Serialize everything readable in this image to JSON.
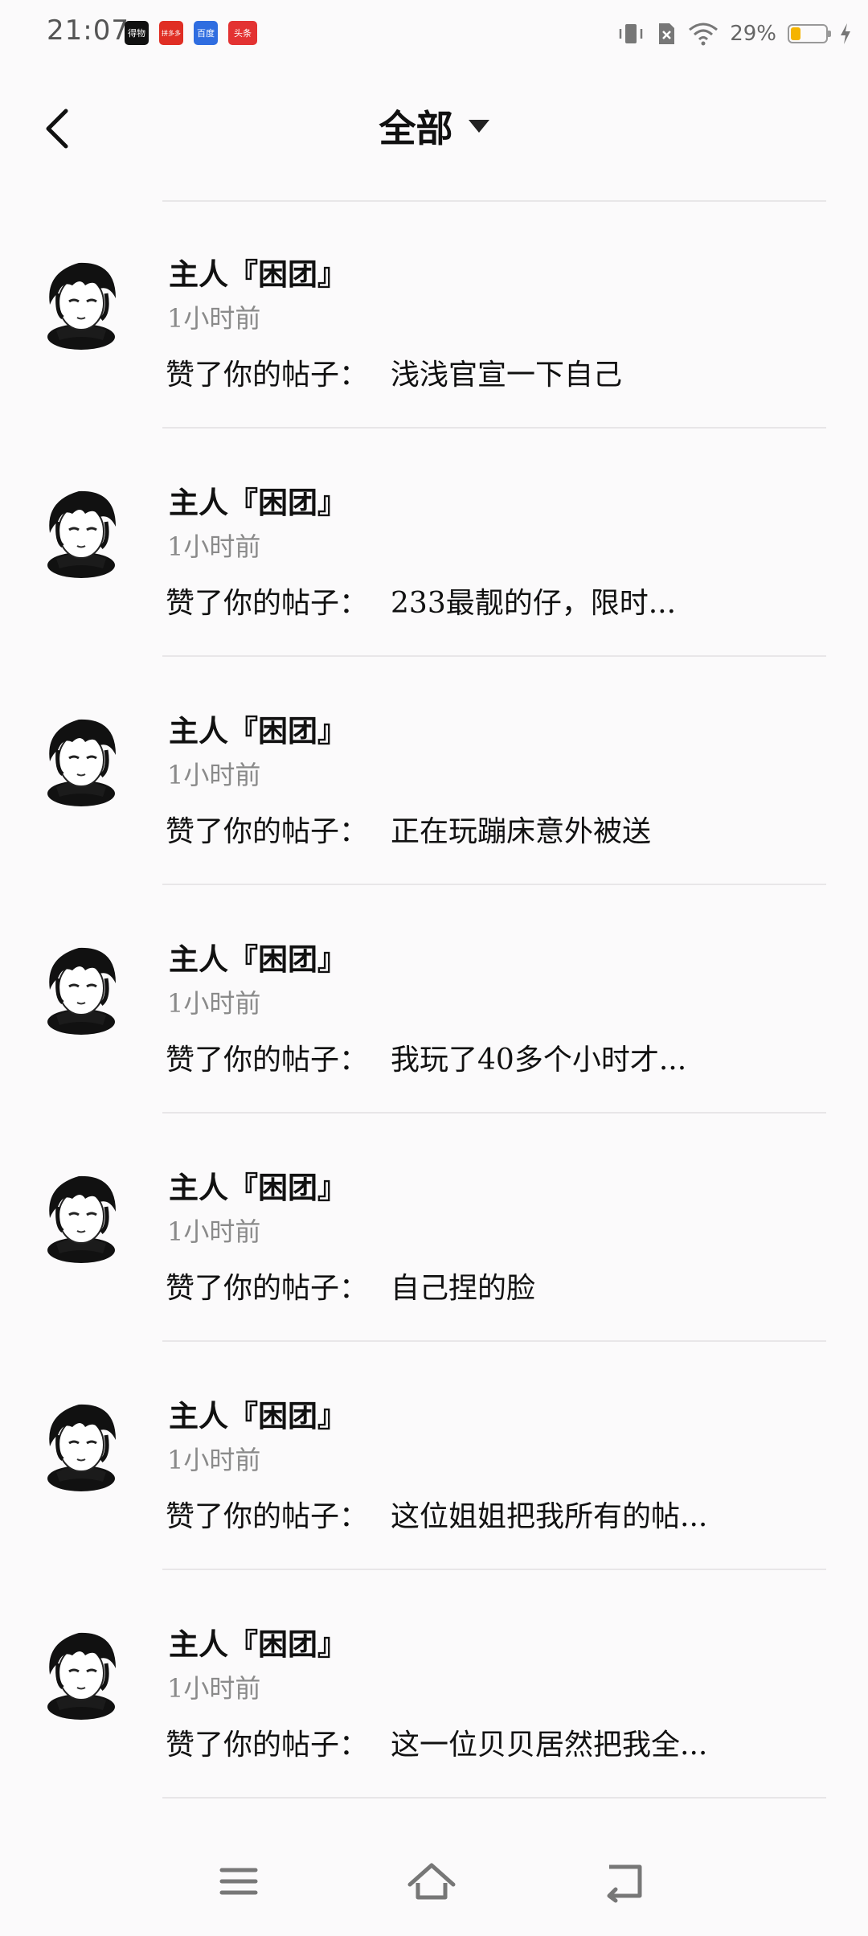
{
  "status_bar": {
    "time": "21:07",
    "apps": [
      {
        "label": "得物",
        "color": "#111111"
      },
      {
        "label": "拼多多",
        "color": "#e02e24"
      },
      {
        "label": "百度",
        "color": "#2f6de0"
      },
      {
        "label": "头条",
        "color": "#e33232"
      }
    ],
    "battery": "29%",
    "battery_level": 0.29,
    "battery_color": "#f5b400"
  },
  "header": {
    "back_icon": "back-arrow-icon",
    "title": "全部",
    "filter_icon": "caret-down-icon"
  },
  "notifications": [
    {
      "user": "主人『困团』",
      "time": "1小时前",
      "prefix": "赞了你的帖子：",
      "post": "浅浅官宣一下自己"
    },
    {
      "user": "主人『困团』",
      "time": "1小时前",
      "prefix": "赞了你的帖子：",
      "post": "233最靓的仔，限时..."
    },
    {
      "user": "主人『困团』",
      "time": "1小时前",
      "prefix": "赞了你的帖子：",
      "post": "正在玩蹦床意外被送"
    },
    {
      "user": "主人『困团』",
      "time": "1小时前",
      "prefix": "赞了你的帖子：",
      "post": "我玩了40多个小时才..."
    },
    {
      "user": "主人『困团』",
      "time": "1小时前",
      "prefix": "赞了你的帖子：",
      "post": "自己捏的脸"
    },
    {
      "user": "主人『困团』",
      "time": "1小时前",
      "prefix": "赞了你的帖子：",
      "post": "这位姐姐把我所有的帖..."
    },
    {
      "user": "主人『困团』",
      "time": "1小时前",
      "prefix": "赞了你的帖子：",
      "post": "这一位贝贝居然把我全..."
    }
  ],
  "nav": {
    "menu_icon": "menu-icon",
    "home_icon": "home-icon",
    "back_icon": "return-icon"
  }
}
